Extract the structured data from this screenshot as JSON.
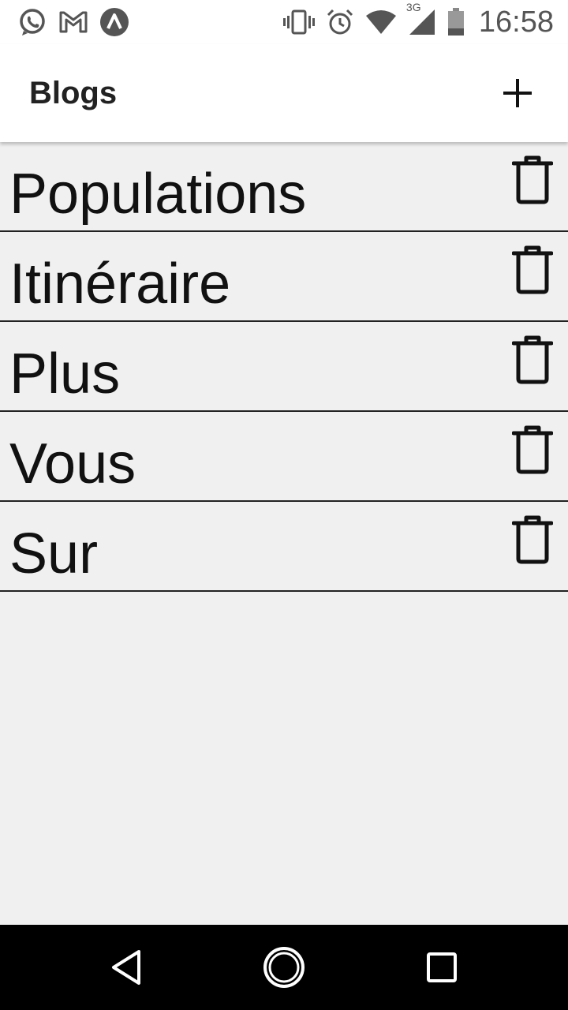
{
  "status_bar": {
    "time": "16:58",
    "network_label": "3G",
    "left_icons": [
      "whatsapp-icon",
      "gmail-icon",
      "app-notification-icon"
    ],
    "right_icons": [
      "vibrate-icon",
      "alarm-icon",
      "wifi-icon",
      "cellular-signal-icon",
      "battery-icon"
    ]
  },
  "app_bar": {
    "title": "Blogs",
    "add_icon": "plus-icon"
  },
  "blogs": [
    {
      "title": "Populations"
    },
    {
      "title": "Itinéraire"
    },
    {
      "title": "Plus"
    },
    {
      "title": "Vous"
    },
    {
      "title": "Sur"
    }
  ],
  "nav_bar": {
    "icons": [
      "back-icon",
      "home-icon",
      "recent-apps-icon"
    ]
  },
  "colors": {
    "background": "#f0f0f0",
    "app_bar": "#ffffff",
    "text": "#111111",
    "divider": "#222222",
    "nav_bar": "#000000",
    "status_icons": "#555555"
  }
}
